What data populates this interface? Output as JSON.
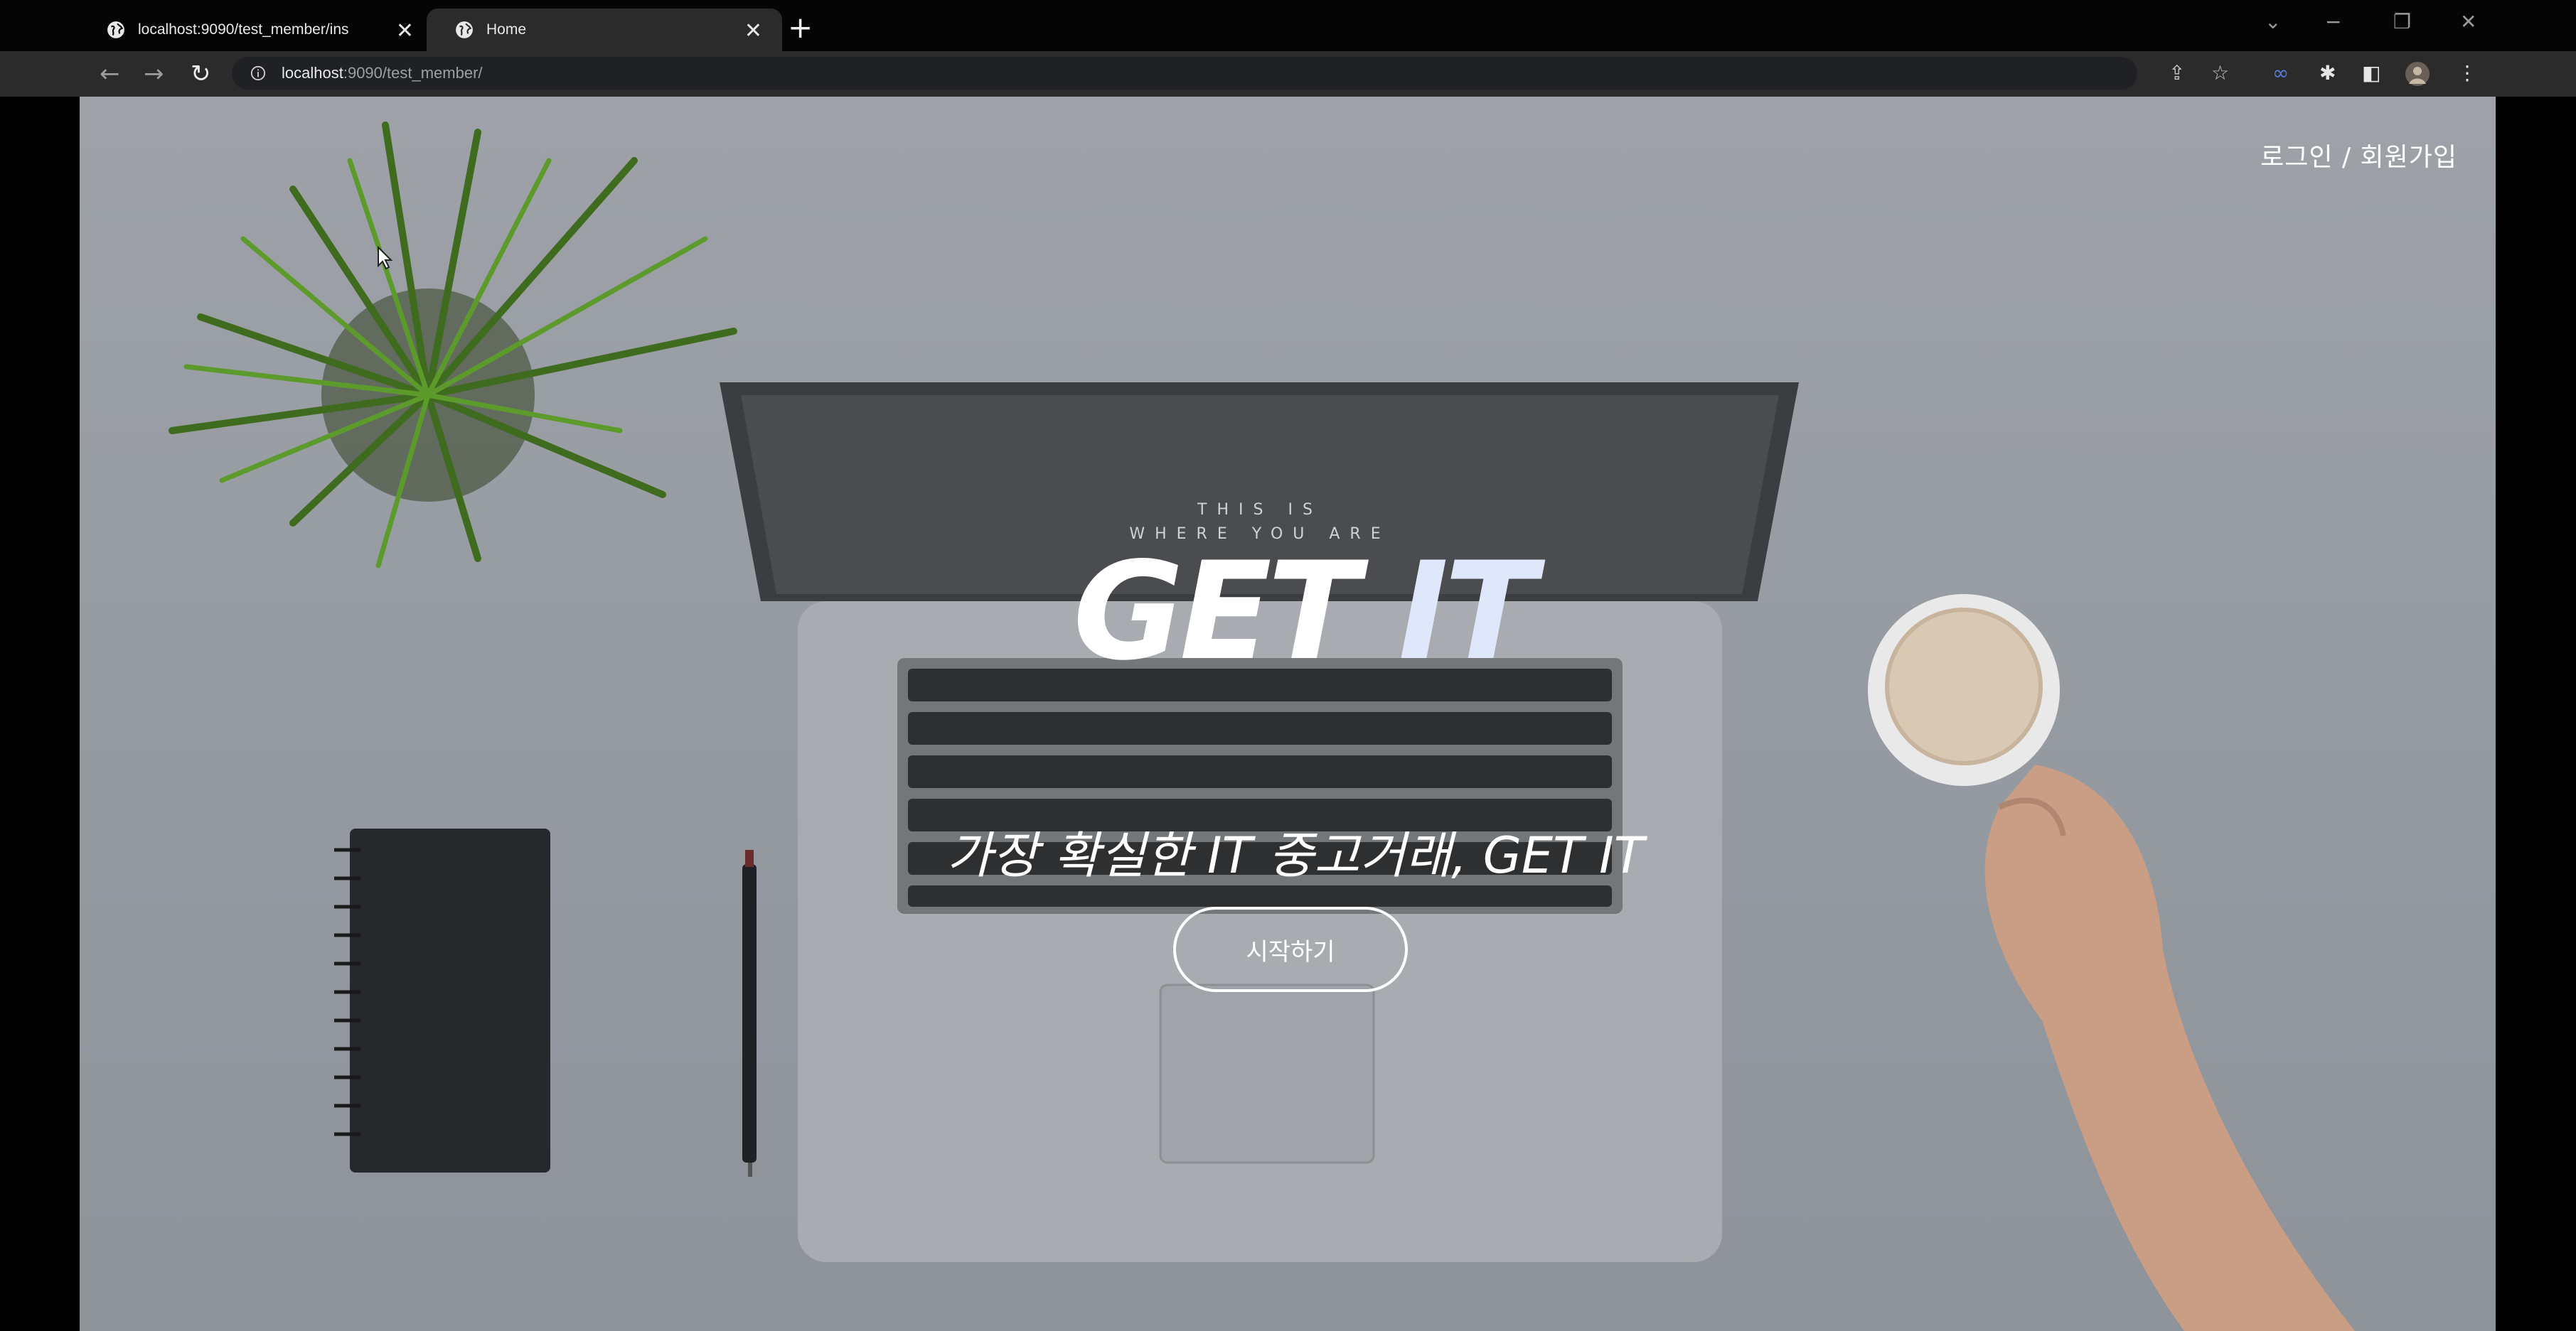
{
  "browser": {
    "tabs": [
      {
        "title": "localhost:9090/test_member/ins"
      },
      {
        "title": "Home"
      }
    ],
    "new_tab_label": "+",
    "address": {
      "host": "localhost",
      "path": ":9090/test_member/"
    }
  },
  "header": {
    "auth_link": "로그인 / 회원가입"
  },
  "hero": {
    "title_word1": "GET",
    "title_word2": "IT",
    "subtitle": "가장 확실한 IT 중고거래, GET IT",
    "start_button": "시작하기"
  },
  "photo": {
    "screen_line1": "THIS IS",
    "screen_line2": "WHERE YOU ARE"
  },
  "colors": {
    "background": "#959aa1",
    "title_accent": "#dfe7fb"
  }
}
